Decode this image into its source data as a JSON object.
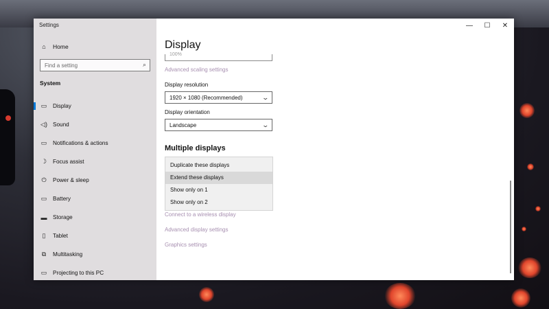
{
  "window": {
    "title": "Settings",
    "controls": {
      "minimize": "—",
      "maximize": "☐",
      "close": "✕"
    }
  },
  "sidebar": {
    "home": {
      "icon": "home-icon",
      "glyph": "⌂",
      "label": "Home"
    },
    "search": {
      "placeholder": "Find a setting",
      "icon": "search-icon",
      "glyph": "⌕"
    },
    "section": "System",
    "items": [
      {
        "label": "Display",
        "icon": "monitor-icon",
        "glyph": "▭",
        "active": true
      },
      {
        "label": "Sound",
        "icon": "speaker-icon",
        "glyph": "◁)"
      },
      {
        "label": "Notifications & actions",
        "icon": "notifications-icon",
        "glyph": "▭"
      },
      {
        "label": "Focus assist",
        "icon": "moon-icon",
        "glyph": "☽"
      },
      {
        "label": "Power & sleep",
        "icon": "power-icon",
        "glyph": "⏻"
      },
      {
        "label": "Battery",
        "icon": "battery-icon",
        "glyph": "▭"
      },
      {
        "label": "Storage",
        "icon": "storage-icon",
        "glyph": "▬"
      },
      {
        "label": "Tablet",
        "icon": "tablet-icon",
        "glyph": "▯"
      },
      {
        "label": "Multitasking",
        "icon": "multitasking-icon",
        "glyph": "⧉"
      },
      {
        "label": "Projecting to this PC",
        "icon": "projecting-icon",
        "glyph": "▭"
      }
    ]
  },
  "content": {
    "title": "Display",
    "scale_value_cut": "100%",
    "advanced_scaling_link": "Advanced scaling settings",
    "resolution": {
      "label": "Display resolution",
      "value": "1920 × 1080 (Recommended)"
    },
    "orientation": {
      "label": "Display orientation",
      "value": "Landscape"
    },
    "multiple_displays": {
      "heading": "Multiple displays",
      "options": [
        "Duplicate these displays",
        "Extend these displays",
        "Show only on 1",
        "Show only on 2"
      ],
      "highlighted": "Extend these displays"
    },
    "links": {
      "wireless": "Connect to a wireless display",
      "advanced_display": "Advanced display settings",
      "graphics": "Graphics settings"
    }
  },
  "colors": {
    "accent": "#0078d7",
    "link": "#a78fb0",
    "sidebar_bg": "#dedadd"
  }
}
